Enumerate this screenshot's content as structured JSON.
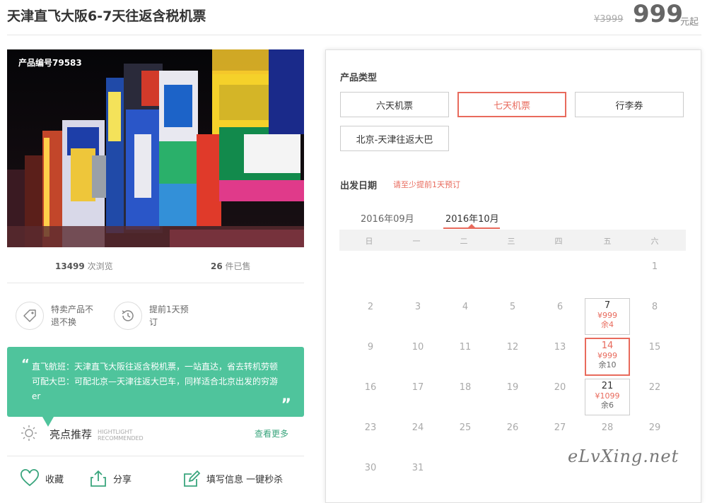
{
  "product": {
    "title": "天津直飞大阪6-7天往返含税机票",
    "price_old": "¥3999",
    "price": "999",
    "price_unit": "元起",
    "product_id": "产品编号79583"
  },
  "stats": {
    "views_count": "13499",
    "views_label": "次浏览",
    "sold_count": "26",
    "sold_label": "件已售"
  },
  "features": [
    {
      "icon": "tag-icon",
      "text": "特卖产品不退不换"
    },
    {
      "icon": "history-clock-icon",
      "text": "提前1天预订"
    }
  ],
  "quote": {
    "line1": "直飞航班：天津直飞大阪往返含税机票，一站直达，省去转机劳顿",
    "line2": "可配大巴：可配北京—天津往返大巴车，同样适合北京出发的穷游",
    "line3": "er"
  },
  "highlight": {
    "title": "亮点推荐",
    "en1": "HIGHTLIGHT",
    "en2": "RECOMMENDED",
    "more": "查看更多"
  },
  "actions": {
    "favorite": "收藏",
    "share": "分享",
    "fill": "填写信息 一键秒杀"
  },
  "booking": {
    "type_label": "产品类型",
    "types": [
      "六天机票",
      "七天机票",
      "行李券",
      "北京-天津往返大巴"
    ],
    "selected_type": "七天机票",
    "date_label": "出发日期",
    "date_note": "请至少提前1天预订",
    "months": [
      "2016年09月",
      "2016年10月"
    ],
    "active_month": "2016年10月",
    "weekdays": [
      "日",
      "一",
      "二",
      "三",
      "四",
      "五",
      "六"
    ],
    "days": {
      "d1": "1",
      "d2": "2",
      "d3": "3",
      "d4": "4",
      "d5": "5",
      "d6": "6",
      "d7": "7",
      "d8": "8",
      "d9": "9",
      "d10": "10",
      "d11": "11",
      "d12": "12",
      "d13": "13",
      "d14": "14",
      "d15": "15",
      "d16": "16",
      "d17": "17",
      "d18": "18",
      "d19": "19",
      "d20": "20",
      "d21": "21",
      "d22": "22",
      "d23": "23",
      "d24": "24",
      "d25": "25",
      "d26": "26",
      "d27": "27",
      "d28": "28",
      "d29": "29",
      "d30": "30",
      "d31": "31"
    },
    "available": {
      "oct7": {
        "price": "¥999",
        "remain": "余4"
      },
      "oct14": {
        "price": "¥999",
        "remain": "余10"
      },
      "oct21": {
        "price": "¥1099",
        "remain": "余6"
      }
    },
    "selected_date": "14"
  },
  "watermark": "eLvXing.net",
  "colors": {
    "accent": "#e86a5c",
    "green": "#4fc49c"
  }
}
